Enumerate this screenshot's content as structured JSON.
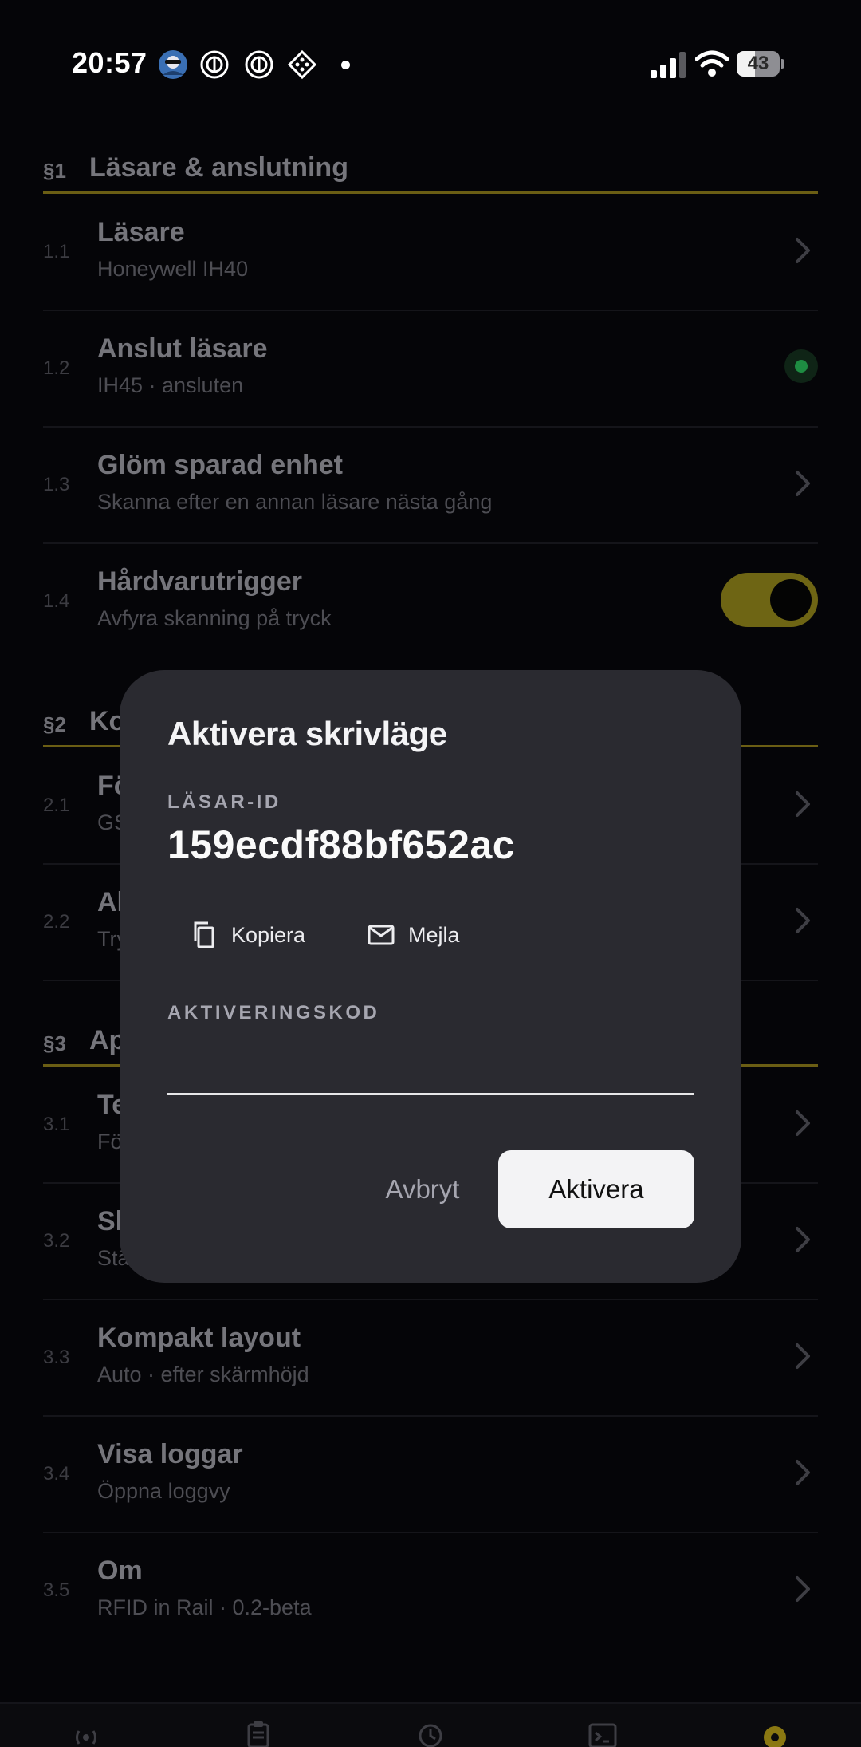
{
  "status_bar": {
    "time": "20:57",
    "battery_level": "43",
    "notification_icons": [
      "avatar-icon",
      "threads-icon",
      "threads-icon",
      "diamond-app-icon"
    ]
  },
  "sections": [
    {
      "num": "§1",
      "title": "Läsare & anslutning",
      "rows": [
        {
          "num": "1.1",
          "title": "Läsare",
          "sub": "Honeywell IH40",
          "control": "chevron"
        },
        {
          "num": "1.2",
          "title": "Anslut läsare",
          "sub": "IH45 · ansluten",
          "control": "status-dot"
        },
        {
          "num": "1.3",
          "title": "Glöm sparad enhet",
          "sub": "Skanna efter en annan läsare nästa gång",
          "control": "chevron"
        },
        {
          "num": "1.4",
          "title": "Hårdvarutrigger",
          "sub": "Avfyra skanning på tryck",
          "control": "toggle",
          "toggle_on": true
        }
      ]
    },
    {
      "num": "§2",
      "title": "Ko",
      "rows": [
        {
          "num": "2.1",
          "title": "Fö",
          "sub": "GS",
          "control": "chevron"
        },
        {
          "num": "2.2",
          "title": "Al",
          "sub": "Try",
          "control": "chevron"
        }
      ]
    },
    {
      "num": "§3",
      "title": "Ap",
      "rows": [
        {
          "num": "3.1",
          "title": "Te",
          "sub": "Fö",
          "control": "chevron"
        },
        {
          "num": "3.2",
          "title": "Sl",
          "sub": "Stä",
          "control": "chevron"
        },
        {
          "num": "3.3",
          "title": "Kompakt layout",
          "sub": "Auto · efter skärmhöjd",
          "control": "chevron"
        },
        {
          "num": "3.4",
          "title": "Visa loggar",
          "sub": "Öppna loggvy",
          "control": "chevron"
        },
        {
          "num": "3.5",
          "title": "Om",
          "sub": "RFID in Rail · 0.2-beta",
          "control": "chevron"
        }
      ]
    }
  ],
  "dialog": {
    "title": "Aktivera skrivläge",
    "reader_id_label": "LÄSAR-ID",
    "reader_id": "159ecdf88bf652ac",
    "copy_label": "Kopiera",
    "email_label": "Mejla",
    "activation_code_label": "AKTIVERINGSKOD",
    "activation_code_value": "",
    "cancel_label": "Avbryt",
    "activate_label": "Aktivera"
  },
  "bottom_nav": {
    "items": [
      "antenna-icon",
      "clipboard-icon",
      "history-icon",
      "terminal-icon",
      "settings-icon"
    ],
    "active": "settings-icon"
  },
  "colors": {
    "background": "#050508",
    "accent": "#6b5e14",
    "accent_bright": "#a08a14",
    "dialog": "#2a2a30",
    "status_green": "#1e8c42"
  }
}
